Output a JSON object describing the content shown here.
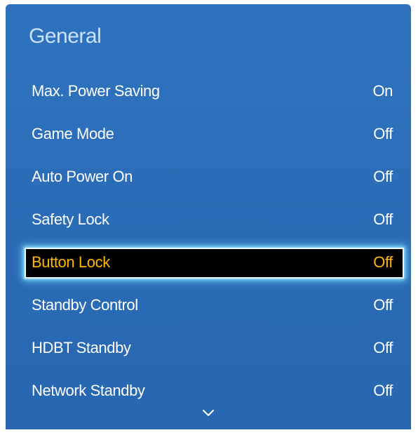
{
  "panel": {
    "title": "General",
    "items": [
      {
        "label": "Max. Power Saving",
        "value": "On"
      },
      {
        "label": "Game Mode",
        "value": "Off"
      },
      {
        "label": "Auto Power On",
        "value": "Off"
      },
      {
        "label": "Safety Lock",
        "value": "Off"
      },
      {
        "label": "Button Lock",
        "value": "Off",
        "selected": true
      },
      {
        "label": "Standby Control",
        "value": "Off"
      },
      {
        "label": "HDBT Standby",
        "value": "Off"
      },
      {
        "label": "Network Standby",
        "value": "Off"
      }
    ],
    "scroll_indicator_icon": "chevron-down-icon"
  },
  "colors": {
    "panel_background": "#2c6db8",
    "title_text": "#cbe2ff",
    "item_text": "#ffffff",
    "selected_background": "#000000",
    "selected_text": "#ffb800",
    "selected_glow": "#78dcff"
  }
}
